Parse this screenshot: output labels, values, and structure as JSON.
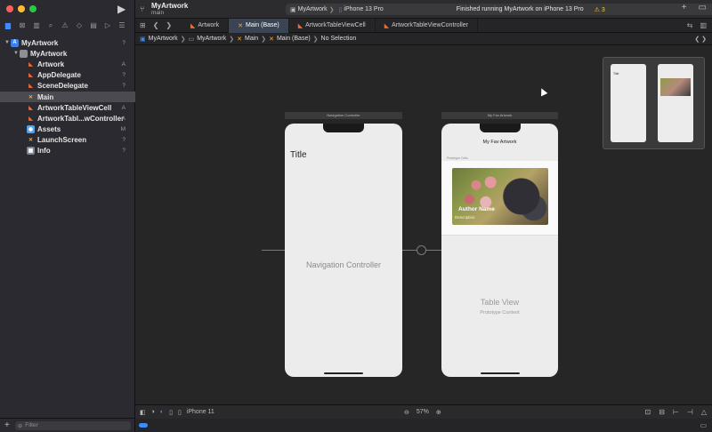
{
  "window": {
    "traffic_colors": [
      "#ff5f57",
      "#febc2e",
      "#28c840"
    ]
  },
  "toolbar": {
    "project_name": "MyArtwork",
    "branch": "main",
    "scheme_project": "MyArtwork",
    "scheme_device": "iPhone 13 Pro",
    "status": "Finished running MyArtwork on iPhone 13 Pro",
    "warning_count": "3"
  },
  "navigator": {
    "items": [
      {
        "label": "MyArtwork",
        "icon": "project-icon",
        "badge": "?"
      },
      {
        "label": "MyArtwork",
        "icon": "folder-icon",
        "badge": ""
      },
      {
        "label": "Artwork",
        "icon": "swift-file-icon",
        "badge": "A"
      },
      {
        "label": "AppDelegate",
        "icon": "swift-file-icon",
        "badge": "?"
      },
      {
        "label": "SceneDelegate",
        "icon": "swift-file-icon",
        "badge": "?"
      },
      {
        "label": "Main",
        "icon": "storyboard-icon",
        "badge": ""
      },
      {
        "label": "ArtworkTableViewCell",
        "icon": "swift-file-icon",
        "badge": "A"
      },
      {
        "label": "ArtworkTabl...wController",
        "icon": "swift-file-icon",
        "badge": "A"
      },
      {
        "label": "Assets",
        "icon": "assets-icon",
        "badge": "M"
      },
      {
        "label": "LaunchScreen",
        "icon": "storyboard-icon",
        "badge": "?"
      },
      {
        "label": "Info",
        "icon": "plist-icon",
        "badge": "?"
      }
    ],
    "filter_placeholder": "Filter"
  },
  "tabs": [
    {
      "label": "Artwork",
      "kind": "swift"
    },
    {
      "label": "Main (Base)",
      "kind": "storyboard"
    },
    {
      "label": "ArtworkTableViewCell",
      "kind": "swift"
    },
    {
      "label": "ArtworkTableViewController",
      "kind": "swift"
    }
  ],
  "jumpbar": {
    "project": "MyArtwork",
    "folder": "MyArtwork",
    "file": "Main",
    "variant": "Main (Base)",
    "selection": "No Selection"
  },
  "canvas": {
    "nav_scene_title": "Navigation Controller",
    "nav_large_title": "Title",
    "nav_center_label": "Navigation Controller",
    "table_scene_title": "My Fav Artwork",
    "table_nav_title": "My Fav Artwork",
    "prototype_cells_label": "Prototype Cells",
    "author_label": "Author Name",
    "description_label": "Description",
    "table_view_label": "Table View",
    "table_view_sub": "Prototype Content"
  },
  "bottombar": {
    "device": "iPhone 11",
    "zoom": "57%"
  }
}
